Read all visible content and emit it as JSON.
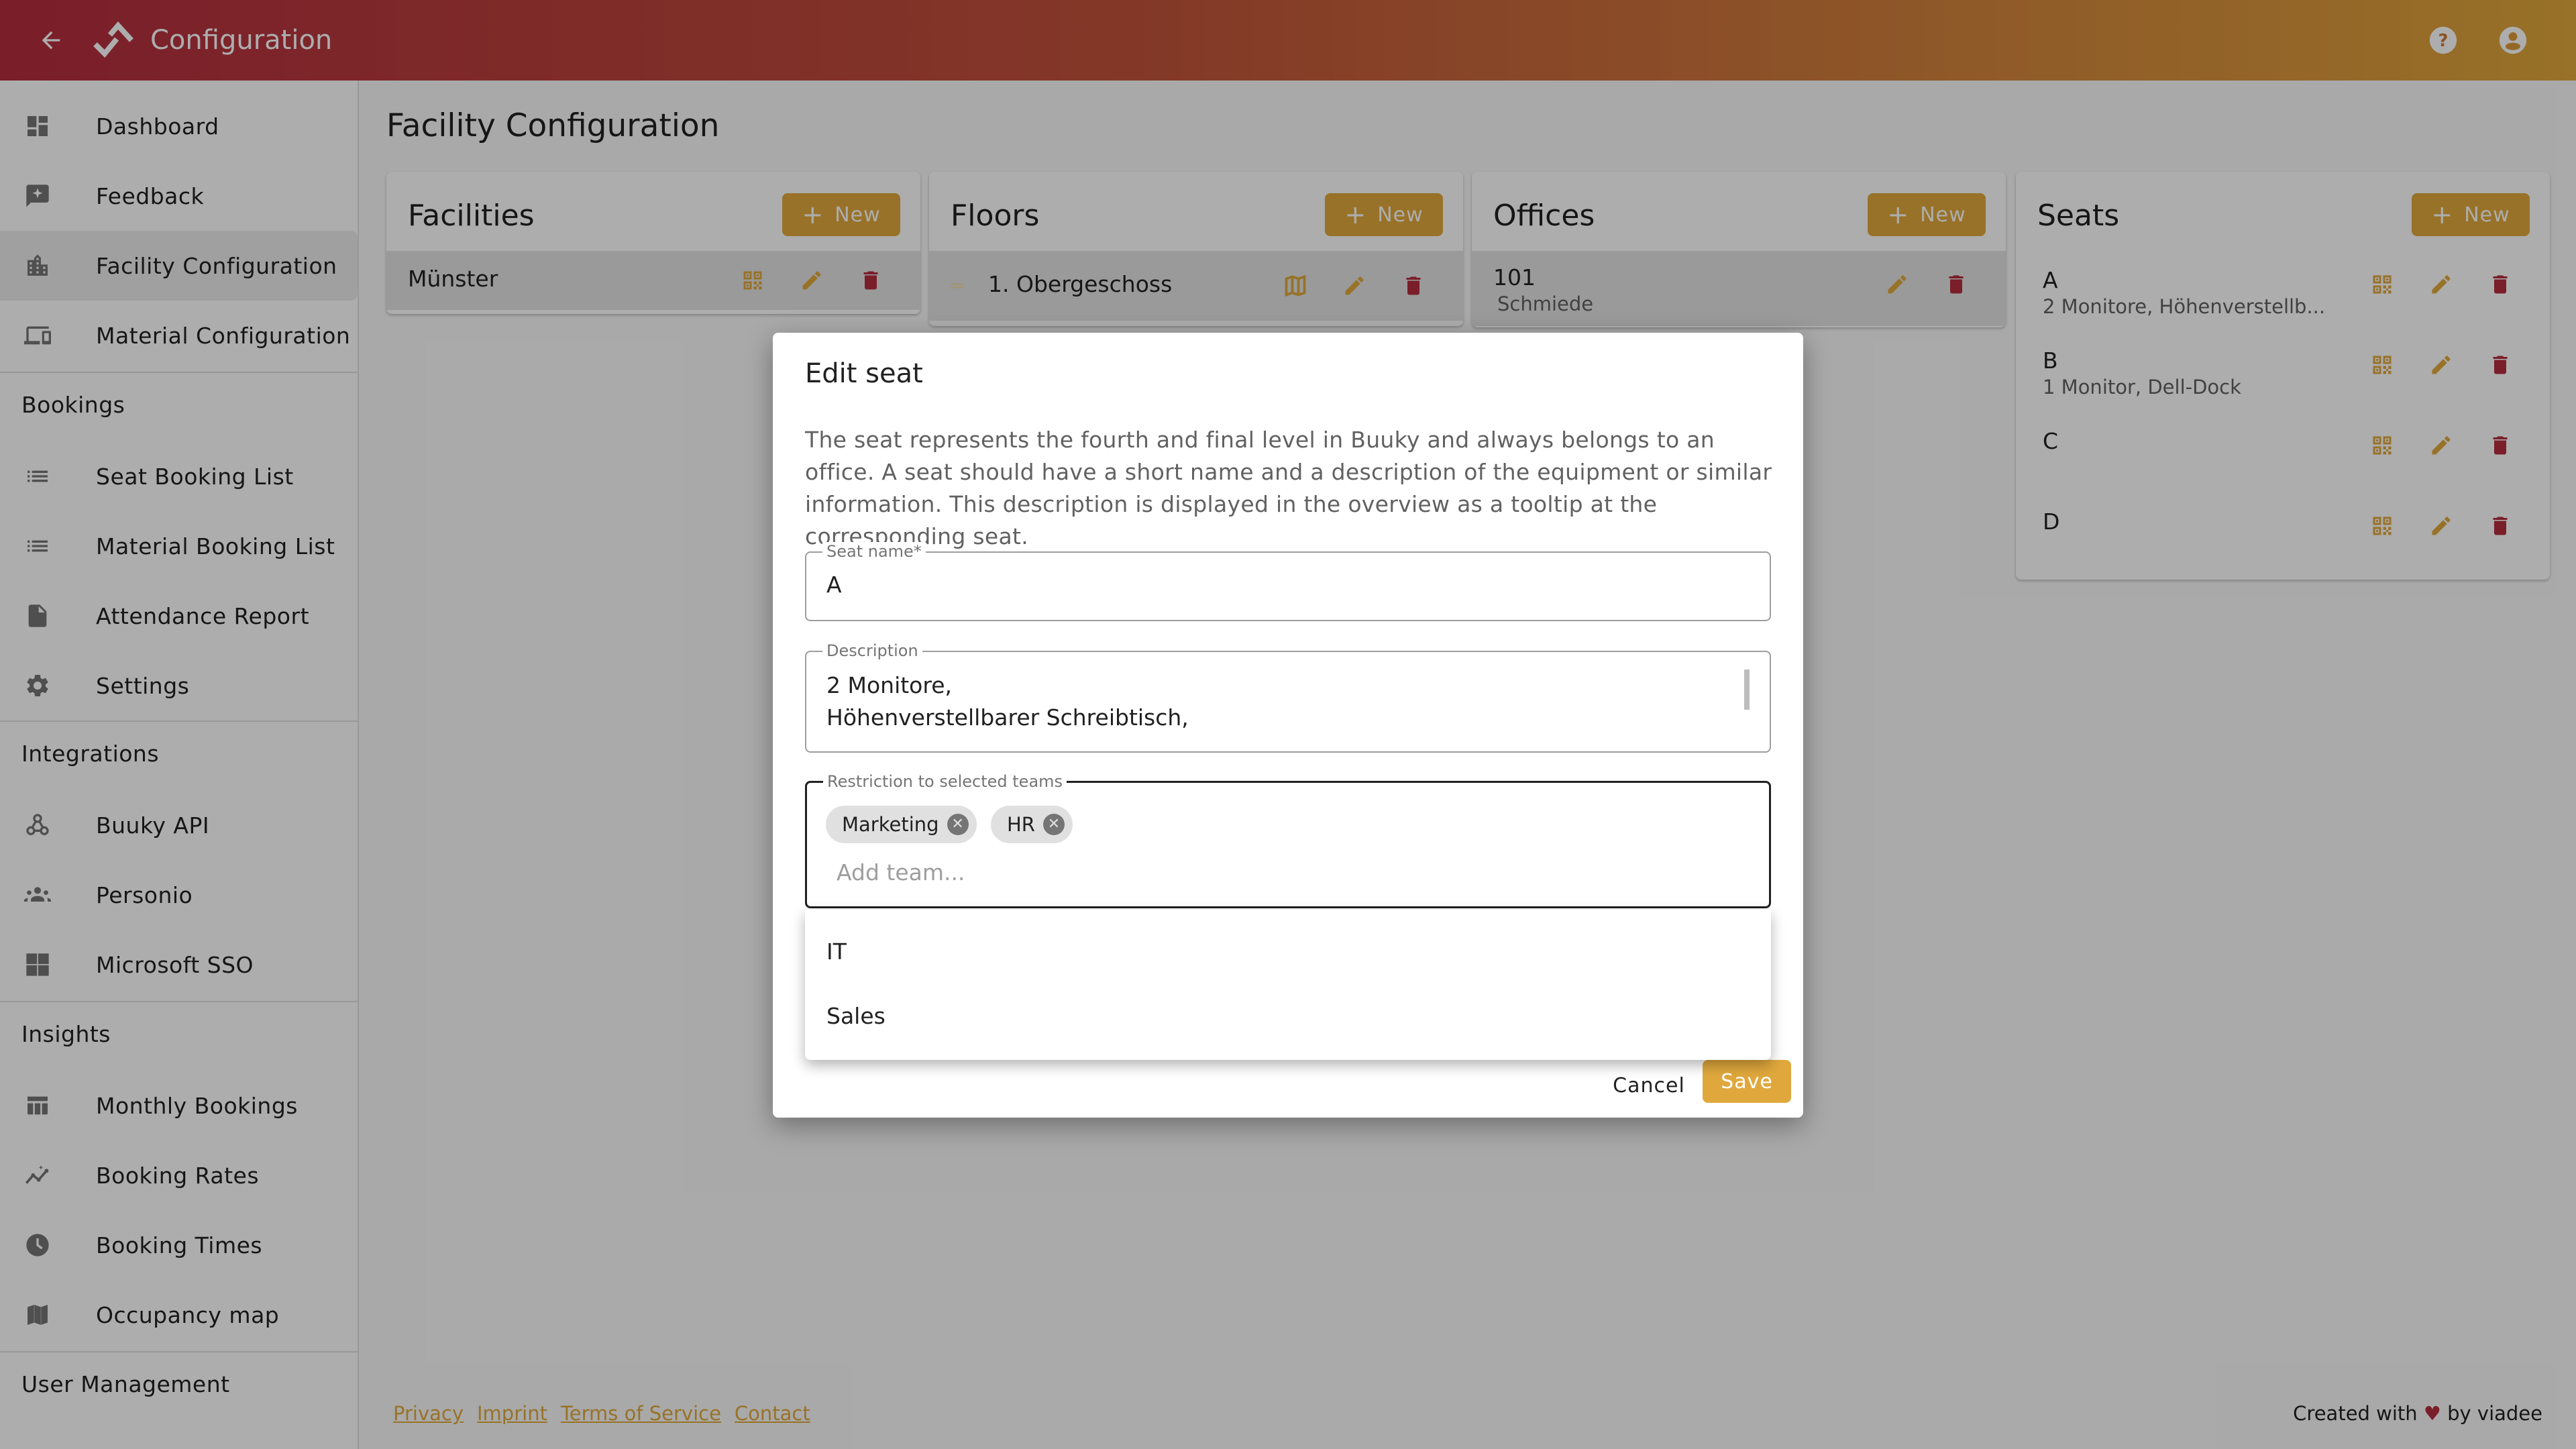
{
  "header": {
    "title": "Configuration",
    "back_icon": "arrow-left",
    "logo_icon": "buuky-logo",
    "help_icon": "help-circle",
    "account_icon": "account-circle"
  },
  "sidebar": {
    "items_top": [
      {
        "label": "Dashboard",
        "icon": "dashboard"
      },
      {
        "label": "Feedback",
        "icon": "feedback"
      },
      {
        "label": "Facility Configuration",
        "icon": "building",
        "active": true
      },
      {
        "label": "Material Configuration",
        "icon": "devices"
      }
    ],
    "sections": [
      {
        "title": "Bookings",
        "items": [
          {
            "label": "Seat Booking List",
            "icon": "list"
          },
          {
            "label": "Material Booking List",
            "icon": "list"
          },
          {
            "label": "Attendance Report",
            "icon": "report"
          },
          {
            "label": "Settings",
            "icon": "gear"
          }
        ]
      },
      {
        "title": "Integrations",
        "items": [
          {
            "label": "Buuky API",
            "icon": "webhook"
          },
          {
            "label": "Personio",
            "icon": "groups"
          },
          {
            "label": "Microsoft SSO",
            "icon": "windows"
          }
        ]
      },
      {
        "title": "Insights",
        "items": [
          {
            "label": "Monthly Bookings",
            "icon": "table"
          },
          {
            "label": "Booking Rates",
            "icon": "trend"
          },
          {
            "label": "Booking Times",
            "icon": "clock"
          },
          {
            "label": "Occupancy map",
            "icon": "map"
          }
        ]
      },
      {
        "title": "User Management",
        "items": []
      }
    ]
  },
  "main": {
    "page_title": "Facility Configuration",
    "new_label": "New",
    "cards": {
      "facilities": {
        "title": "Facilities",
        "items": [
          {
            "name": "Münster"
          }
        ]
      },
      "floors": {
        "title": "Floors",
        "items": [
          {
            "name": "1. Obergeschoss"
          }
        ]
      },
      "offices": {
        "title": "Offices",
        "items": [
          {
            "name": "101",
            "description": "Schmiede"
          }
        ]
      },
      "seats": {
        "title": "Seats",
        "items": [
          {
            "name": "A",
            "description": "2 Monitore, Höhenverstellb..."
          },
          {
            "name": "B",
            "description": "1 Monitor, Dell-Dock"
          },
          {
            "name": "C",
            "description": ""
          },
          {
            "name": "D",
            "description": ""
          }
        ]
      }
    }
  },
  "dialog": {
    "title": "Edit seat",
    "description": "The seat represents the fourth and final level in Buuky and always belongs to an office. A seat should have a short name and a description of the equipment or similar information. This description is displayed in the overview as a tooltip at the corresponding seat.",
    "seat_name_label": "Seat name*",
    "seat_name_value": "A",
    "description_label": "Description",
    "description_value": "2 Monitore,\nHöhenverstellbarer Schreibtisch,",
    "teams_label": "Restriction to selected teams",
    "selected_teams": [
      "Marketing",
      "HR"
    ],
    "add_team_placeholder": "Add team...",
    "team_options": [
      "IT",
      "Sales"
    ],
    "cancel_label": "Cancel",
    "save_label": "Save"
  },
  "footer": {
    "links": [
      "Privacy",
      "Imprint",
      "Terms of Service",
      "Contact"
    ],
    "credit_prefix": "Created with",
    "credit_heart": "♥",
    "credit_suffix": "by viadee"
  },
  "colors": {
    "primary": "#e0a83c",
    "danger": "#b42d3f",
    "header_start": "#b42d3f",
    "header_end": "#e0a83c"
  }
}
